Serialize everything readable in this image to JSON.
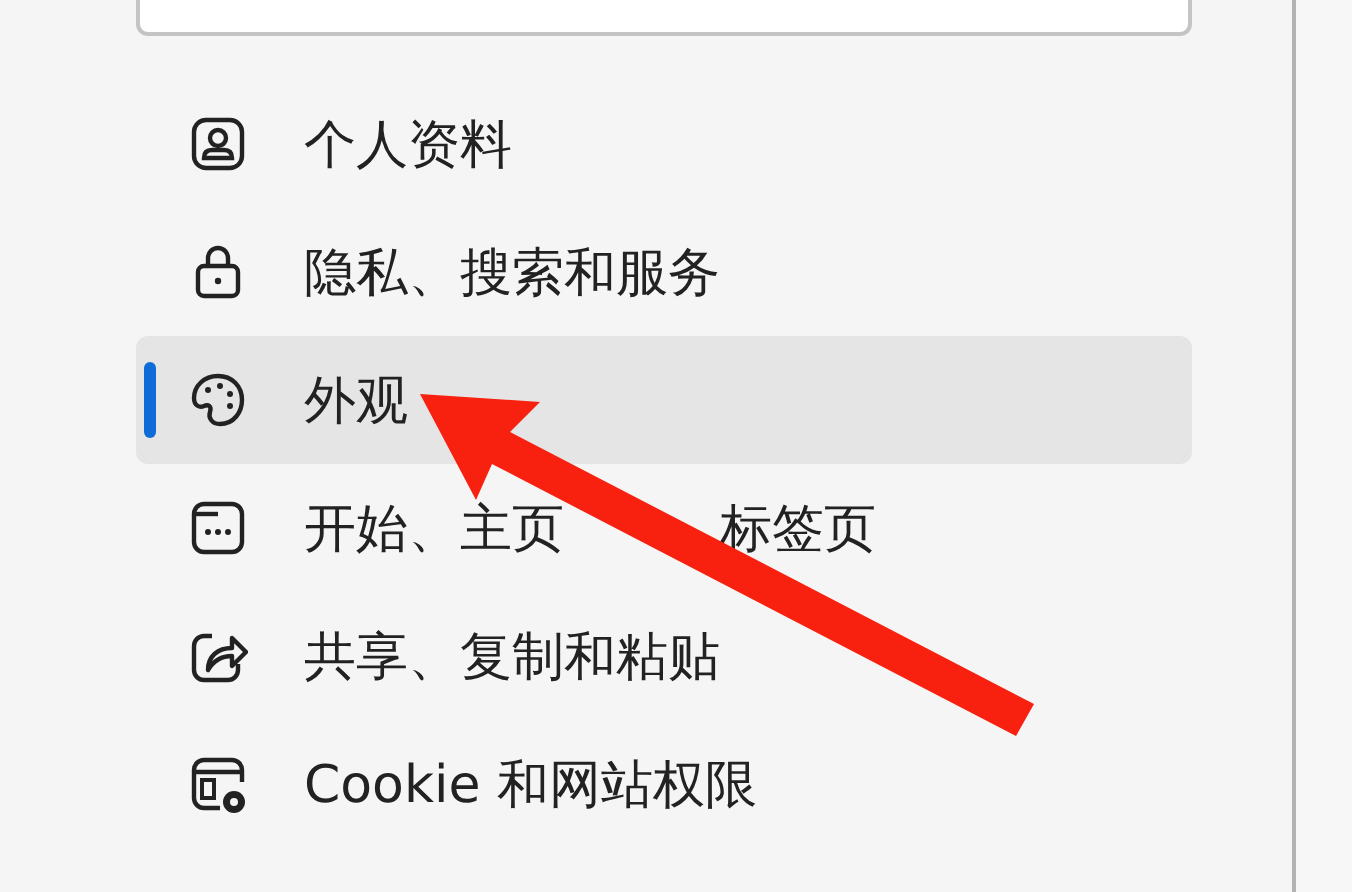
{
  "sidebar": {
    "items": [
      {
        "label": "个人资料",
        "selected": false
      },
      {
        "label": "隐私、搜索和服务",
        "selected": false
      },
      {
        "label": "外观",
        "selected": true
      },
      {
        "label": "开始、主页",
        "label_tail": "标签页",
        "selected": false
      },
      {
        "label": "共享、复制和粘贴",
        "selected": false
      },
      {
        "label": "Cookie 和网站权限",
        "selected": false
      }
    ]
  }
}
